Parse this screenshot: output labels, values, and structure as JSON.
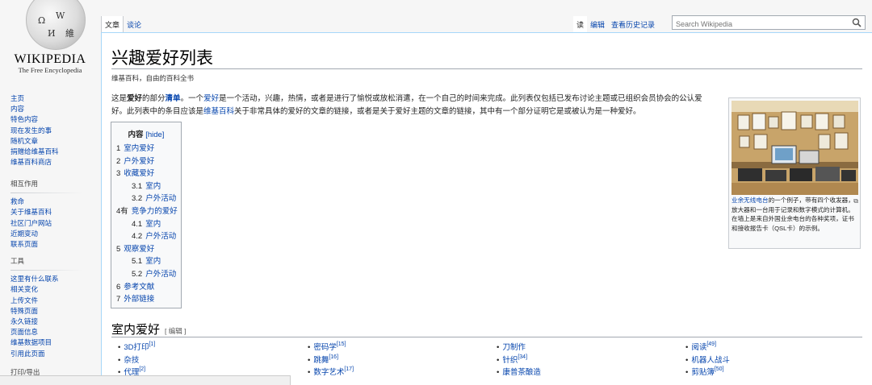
{
  "logo": {
    "wordmark": "WIKIPEDIA",
    "tagline": "The Free Encyclopedia"
  },
  "sidebar": {
    "nav": [
      "主页",
      "内容",
      "特色内容",
      "现在发生的事",
      "随机文章",
      "捐赠给维基百科",
      "维基百科商店"
    ],
    "interaction": {
      "heading": "相互作用",
      "items": [
        "救命",
        "关于维基百科",
        "社区门户网站",
        "近期变动",
        "联系页面"
      ]
    },
    "tools": {
      "heading": "工具",
      "items": [
        "这里有什么联系",
        "相关变化",
        "上传文件",
        "特殊页面",
        "永久链接",
        "页面信息",
        "维基数据项目",
        "引用此页面"
      ]
    },
    "print": {
      "heading": "打印/导出"
    }
  },
  "tabs": {
    "left": [
      "文章",
      "谈论"
    ],
    "right": [
      "读",
      "编辑",
      "查看历史记录"
    ]
  },
  "search": {
    "placeholder": "Search Wikipedia"
  },
  "page": {
    "title": "兴趣爱好列表",
    "sitesub": "维基百科，自由的百科全书",
    "intro": {
      "p1": "这是",
      "b1": "爱好",
      "p2": "的部分",
      "b2": "清单",
      "p3": "。一个",
      "l1": "爱好",
      "p4": "是一个活动，兴趣，热情，或者是进行了愉悦或放松消遣，在一个自己的时间来完成。此列表仅包括已发布讨论主题或已组织会员协会的公认爱好。此列表中的条目应该是",
      "l2": "维基百科",
      "p5": "关于非常具体的爱好的文章的链接，或者是关于爱好主题的文章的链接，其中有一个部分证明它是或被认为是一种爱好。"
    }
  },
  "toc": {
    "title": "内容",
    "hide": "[hide]",
    "items": [
      {
        "num": "1",
        "label": "室内爱好",
        "level": 1
      },
      {
        "num": "2",
        "label": "户外爱好",
        "level": 1
      },
      {
        "num": "3",
        "label": "收藏爱好",
        "level": 1
      },
      {
        "num": "3.1",
        "label": "室内",
        "level": 2
      },
      {
        "num": "3.2",
        "label": "户外活动",
        "level": 2
      },
      {
        "num": "4有",
        "label": "竞争力的爱好",
        "level": 1
      },
      {
        "num": "4.1",
        "label": "室内",
        "level": 2
      },
      {
        "num": "4.2",
        "label": "户外活动",
        "level": 2
      },
      {
        "num": "5",
        "label": "观察爱好",
        "level": 1
      },
      {
        "num": "5.1",
        "label": "室内",
        "level": 2
      },
      {
        "num": "5.2",
        "label": "户外活动",
        "level": 2
      },
      {
        "num": "6",
        "label": "参考文献",
        "level": 1
      },
      {
        "num": "7",
        "label": "外部链接",
        "level": 1
      }
    ]
  },
  "thumb": {
    "caption_link": "业余无线电台",
    "caption": "的一个例子，带有四个收发器，放大器和一台用于记录和数字模式的计算机。在墙上是来自外国业余电台的各种奖项，证书和接收报告卡（QSL卡）的示例。"
  },
  "section": {
    "title": "室内爱好",
    "edit": "[ 编辑 ]",
    "columns": [
      [
        {
          "t": "3D打印",
          "r": "[1]"
        },
        {
          "t": "杂技",
          "r": ""
        },
        {
          "t": "代理",
          "r": "[2]"
        }
      ],
      [
        {
          "t": "密码学",
          "r": "[15]"
        },
        {
          "t": "跳舞",
          "r": "[16]"
        },
        {
          "t": "数字艺术",
          "r": "[17]"
        }
      ],
      [
        {
          "t": "刀制作",
          "r": ""
        },
        {
          "t": "针织",
          "r": "[34]"
        },
        {
          "t": "康普茶酿造",
          "r": ""
        }
      ],
      [
        {
          "t": "阅读",
          "r": "[49]"
        },
        {
          "t": "机器人战斗",
          "r": ""
        },
        {
          "t": "剪贴簿",
          "r": "[50]"
        }
      ]
    ]
  },
  "colors": {
    "link": "#0645ad",
    "border": "#a7d7f9"
  }
}
